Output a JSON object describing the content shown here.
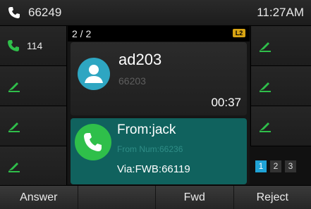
{
  "status_bar": {
    "account": "66249",
    "time": "11:27AM"
  },
  "line_keys_left": [
    {
      "label": "114",
      "icon": "call-icon"
    },
    {
      "label": "",
      "icon": "line-key-icon"
    },
    {
      "label": "",
      "icon": "line-key-icon"
    },
    {
      "label": "",
      "icon": "line-key-icon"
    }
  ],
  "line_keys_right": [
    {
      "label": "",
      "icon": "line-key-icon"
    },
    {
      "label": "",
      "icon": "line-key-icon"
    },
    {
      "label": "",
      "icon": "line-key-icon"
    }
  ],
  "call_panel": {
    "call_count": "2 / 2",
    "line_badge": "L2",
    "active_call": {
      "name": "ad203",
      "number": "66203",
      "duration": "00:37"
    },
    "incoming_call": {
      "from": "From:jack",
      "from_num": "From Num:66236",
      "via": "Via:FWB:66119"
    }
  },
  "pages": [
    "1",
    "2",
    "3"
  ],
  "softkeys": [
    "Answer",
    "",
    "Fwd",
    "Reject"
  ],
  "colors": {
    "accent_green": "#2fbf4a",
    "incoming_bg": "#10625e",
    "avatar": "#2ea6c2",
    "page_active": "#1fa3d6",
    "badge": "#d7a313"
  }
}
